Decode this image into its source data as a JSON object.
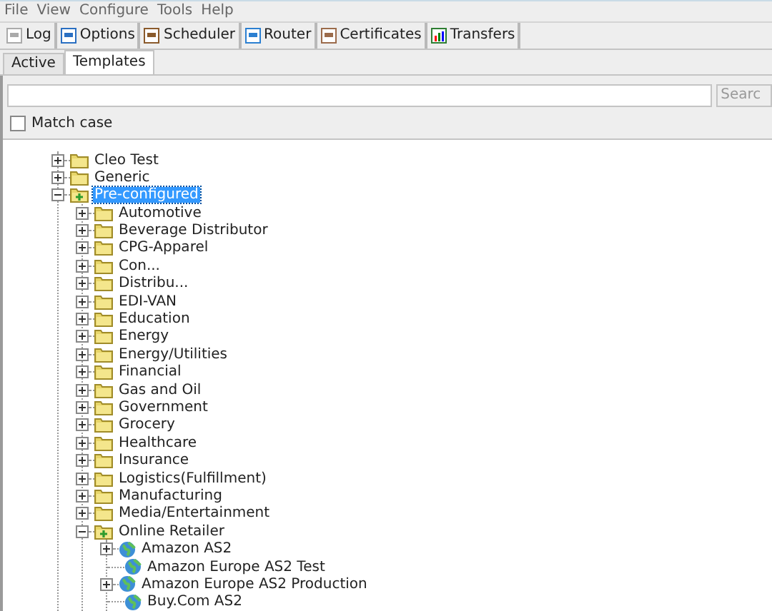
{
  "menu": [
    "File",
    "View",
    "Configure",
    "Tools",
    "Help"
  ],
  "toolbar": [
    {
      "label": "Log",
      "kind": "log"
    },
    {
      "label": "Options",
      "kind": "options"
    },
    {
      "label": "Scheduler",
      "kind": "scheduler"
    },
    {
      "label": "Router",
      "kind": "router"
    },
    {
      "label": "Certificates",
      "kind": "certificates"
    },
    {
      "label": "Transfers",
      "kind": "transfers"
    }
  ],
  "tabs": [
    {
      "label": "Active",
      "selected": false
    },
    {
      "label": "Templates",
      "selected": true
    }
  ],
  "search": {
    "button": "Searc"
  },
  "match_case": {
    "label": "Match case",
    "checked": false
  },
  "tree": [
    {
      "label": "Cleo Test",
      "kind": "folder",
      "expanded": false,
      "selected": false
    },
    {
      "label": "Generic",
      "kind": "folder",
      "expanded": false,
      "selected": false
    },
    {
      "label": "Pre-configured",
      "kind": "group",
      "expanded": true,
      "selected": true,
      "children": [
        {
          "label": "Automotive",
          "kind": "folder",
          "expanded": false,
          "selected": false
        },
        {
          "label": "Beverage Distributor",
          "kind": "folder",
          "expanded": false,
          "selected": false
        },
        {
          "label": "CPG-Apparel",
          "kind": "folder",
          "expanded": false,
          "selected": false
        },
        {
          "label": "Con...",
          "kind": "folder",
          "expanded": false,
          "selected": false
        },
        {
          "label": "Distribu...",
          "kind": "folder",
          "expanded": false,
          "selected": false
        },
        {
          "label": "EDI-VAN",
          "kind": "folder",
          "expanded": false,
          "selected": false
        },
        {
          "label": "Education",
          "kind": "folder",
          "expanded": false,
          "selected": false
        },
        {
          "label": "Energy",
          "kind": "folder",
          "expanded": false,
          "selected": false
        },
        {
          "label": "Energy/Utilities",
          "kind": "folder",
          "expanded": false,
          "selected": false
        },
        {
          "label": "Financial",
          "kind": "folder",
          "expanded": false,
          "selected": false
        },
        {
          "label": "Gas and Oil",
          "kind": "folder",
          "expanded": false,
          "selected": false
        },
        {
          "label": "Government",
          "kind": "folder",
          "expanded": false,
          "selected": false
        },
        {
          "label": "Grocery",
          "kind": "folder",
          "expanded": false,
          "selected": false
        },
        {
          "label": "Healthcare",
          "kind": "folder",
          "expanded": false,
          "selected": false
        },
        {
          "label": "Insurance",
          "kind": "folder",
          "expanded": false,
          "selected": false
        },
        {
          "label": "Logistics(Fulfillment)",
          "kind": "folder",
          "expanded": false,
          "selected": false
        },
        {
          "label": "Manufacturing",
          "kind": "folder",
          "expanded": false,
          "selected": false
        },
        {
          "label": "Media/Entertainment",
          "kind": "folder",
          "expanded": false,
          "selected": false
        },
        {
          "label": "Online Retailer",
          "kind": "group",
          "expanded": true,
          "selected": false,
          "children": [
            {
              "label": "Amazon AS2",
              "kind": "globe",
              "expanded": false,
              "selected": false
            },
            {
              "label": "Amazon Europe AS2 Test",
              "kind": "globe",
              "selected": false
            },
            {
              "label": "Amazon Europe AS2 Production",
              "kind": "globe",
              "expanded": false,
              "selected": false
            },
            {
              "label": "Buy.Com AS2",
              "kind": "globe",
              "selected": false
            }
          ]
        }
      ]
    }
  ]
}
